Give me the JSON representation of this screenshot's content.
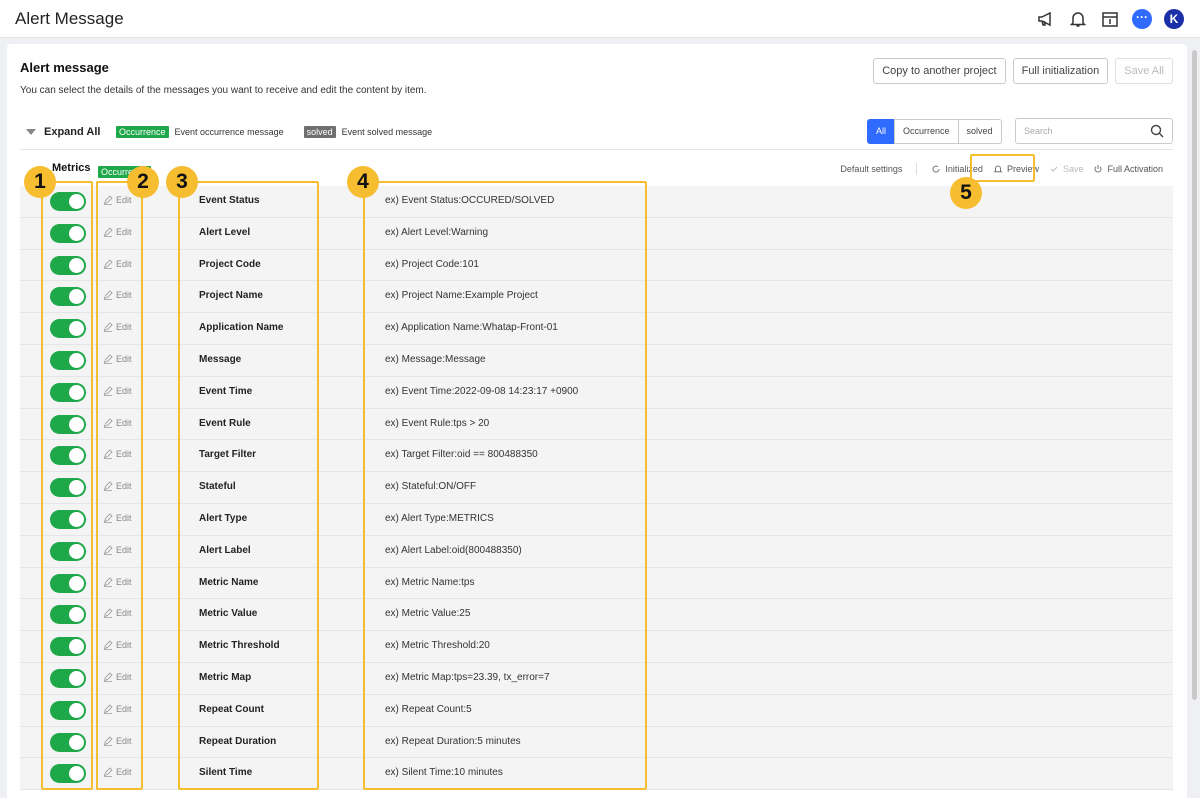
{
  "app": {
    "title": "Alert Message",
    "avatar_initial": "K",
    "chat_glyph": "···"
  },
  "card": {
    "title": "Alert message",
    "description": "You can select the details of the messages you want to receive and edit the content by item.",
    "buttons": {
      "copy": "Copy to another project",
      "init": "Full initialization",
      "save_all": "Save All"
    }
  },
  "filter": {
    "expand_all": "Expand All",
    "legend_occurrence_tag": "Occurrence",
    "legend_occurrence_text": "Event occurrence message",
    "legend_solved_tag": "solved",
    "legend_solved_text": "Event solved message",
    "segments": {
      "all": "All",
      "occurrence": "Occurrence",
      "solved": "solved"
    },
    "search_placeholder": "Search"
  },
  "section": {
    "name": "Metrics",
    "tag": "Occurrence",
    "actions": {
      "default_settings": "Default settings",
      "initialized": "Initialized",
      "preview": "Preview",
      "save": "Save",
      "full_activation": "Full Activation"
    }
  },
  "edit_label": "Edit",
  "rows": [
    {
      "name": "Event Status",
      "example": "ex) Event Status:OCCURED/SOLVED",
      "enabled": true
    },
    {
      "name": "Alert Level",
      "example": "ex) Alert Level:Warning",
      "enabled": true
    },
    {
      "name": "Project Code",
      "example": "ex) Project Code:101",
      "enabled": true
    },
    {
      "name": "Project Name",
      "example": "ex) Project Name:Example Project",
      "enabled": true
    },
    {
      "name": "Application Name",
      "example": "ex) Application Name:Whatap-Front-01",
      "enabled": true
    },
    {
      "name": "Message",
      "example": "ex) Message:Message",
      "enabled": true
    },
    {
      "name": "Event Time",
      "example": "ex) Event Time:2022-09-08 14:23:17 +0900",
      "enabled": true
    },
    {
      "name": "Event Rule",
      "example": "ex) Event Rule:tps > 20",
      "enabled": true
    },
    {
      "name": "Target Filter",
      "example": "ex) Target Filter:oid == 800488350",
      "enabled": true
    },
    {
      "name": "Stateful",
      "example": "ex) Stateful:ON/OFF",
      "enabled": true
    },
    {
      "name": "Alert Type",
      "example": "ex) Alert Type:METRICS",
      "enabled": true
    },
    {
      "name": "Alert Label",
      "example": "ex) Alert Label:oid(800488350)",
      "enabled": true
    },
    {
      "name": "Metric Name",
      "example": "ex) Metric Name:tps",
      "enabled": true
    },
    {
      "name": "Metric Value",
      "example": "ex) Metric Value:25",
      "enabled": true
    },
    {
      "name": "Metric Threshold",
      "example": "ex) Metric Threshold:20",
      "enabled": true
    },
    {
      "name": "Metric Map",
      "example": "ex) Metric Map:tps=23.39, tx_error=7",
      "enabled": true
    },
    {
      "name": "Repeat Count",
      "example": "ex) Repeat Count:5",
      "enabled": true
    },
    {
      "name": "Repeat Duration",
      "example": "ex) Repeat Duration:5 minutes",
      "enabled": true
    },
    {
      "name": "Silent Time",
      "example": "ex) Silent Time:10 minutes",
      "enabled": true
    }
  ],
  "annotations": [
    "1",
    "2",
    "3",
    "4",
    "5"
  ],
  "colors": {
    "accent": "#2f6bff",
    "toggle_on": "#1fa84a",
    "highlight": "#f5bd2f"
  }
}
